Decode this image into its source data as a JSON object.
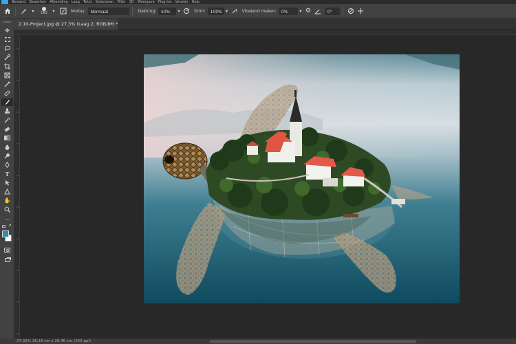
{
  "menubar": {
    "items": [
      "Bestand",
      "Bewerken",
      "Afbeelding",
      "Laag",
      "Tekst",
      "Selecteren",
      "Filter",
      "3D",
      "Weergave",
      "Plug-ins",
      "Venster",
      "Help"
    ]
  },
  "options": {
    "brush_size": "160",
    "mode_label": "Modus:",
    "mode_value": "Normaal",
    "opacity_label": "Dekking:",
    "opacity_value": "50%",
    "flow_label": "Strm:",
    "flow_value": "100%",
    "smoothing_label": "Vloeiend maken:",
    "smoothing_value": "0%",
    "angle_value": "0°"
  },
  "document": {
    "tab_title": "2.10-Project.jpg @ 27,3% (Laag 2, RGB/8*) *",
    "close": "×"
  },
  "status": {
    "text": "27,32%   36,16 cm x 28,46 cm (240 ppi)"
  },
  "tools": [
    "move-tool",
    "marquee-tool",
    "lasso-tool",
    "quick-select-tool",
    "crop-tool",
    "frame-tool",
    "eyedropper-tool",
    "healing-tool",
    "brush-tool",
    "stamp-tool",
    "history-brush-tool",
    "eraser-tool",
    "gradient-tool",
    "blur-tool",
    "dodge-tool",
    "pen-tool",
    "type-tool",
    "path-select-tool",
    "shape-tool",
    "hand-tool",
    "zoom-tool",
    "more-tools"
  ],
  "colors": {
    "foreground": "#2a8fa5",
    "background": "#ffffff",
    "accent": "#31a8ff"
  }
}
